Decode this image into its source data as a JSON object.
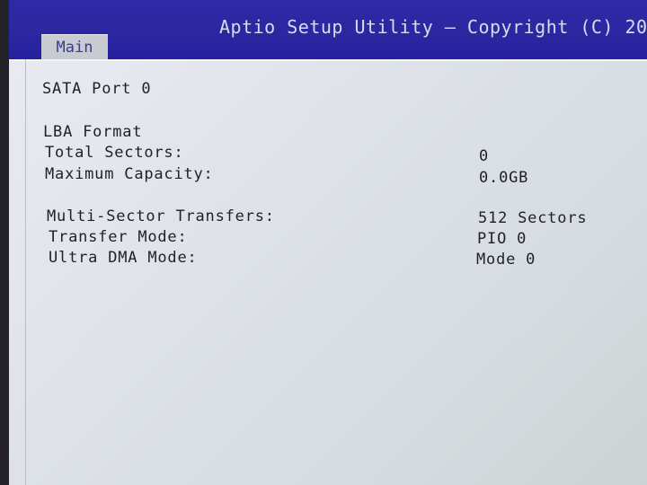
{
  "header": {
    "title": "Aptio Setup Utility – Copyright (C) 20",
    "tab": "Main"
  },
  "content": {
    "section_title": "SATA Port 0",
    "group_title": "LBA Format",
    "rows": [
      {
        "label": "Total Sectors:",
        "value": "0"
      },
      {
        "label": "Maximum Capacity:",
        "value": "0.0GB"
      },
      {
        "label": "Multi-Sector Transfers:",
        "value": "512 Sectors"
      },
      {
        "label": "Transfer Mode:",
        "value": "PIO 0"
      },
      {
        "label": "Ultra DMA Mode:",
        "value": "Mode 0"
      }
    ]
  },
  "colors": {
    "header_bg": "#2a27a0",
    "header_text": "#d9dcf0",
    "panel_bg": "#dfe3e8",
    "text": "#1f2028"
  }
}
